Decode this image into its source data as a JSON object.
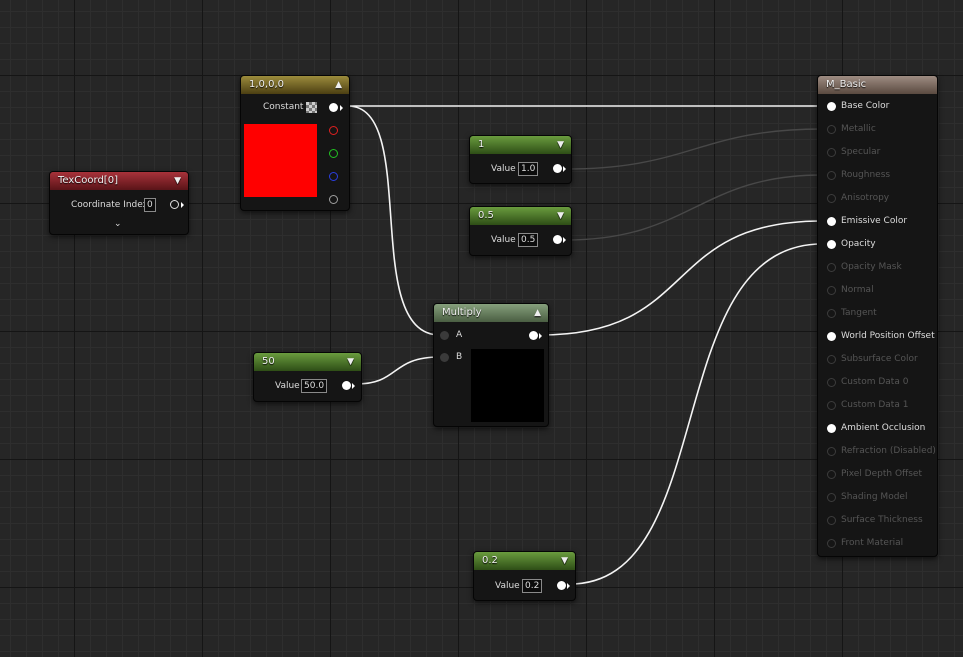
{
  "nodes": {
    "texcoord": {
      "title": "TexCoord[0]",
      "pin_label": "Coordinate Index",
      "value": "0"
    },
    "constant": {
      "title": "1,0,0,0",
      "pin_label": "Constant"
    },
    "const1": {
      "title": "1",
      "pin_label": "Value",
      "value": "1.0"
    },
    "const05": {
      "title": "0.5",
      "pin_label": "Value",
      "value": "0.5"
    },
    "const50": {
      "title": "50",
      "pin_label": "Value",
      "value": "50.0"
    },
    "multiply": {
      "title": "Multiply",
      "input_a": "A",
      "input_b": "B"
    },
    "const02": {
      "title": "0.2",
      "pin_label": "Value",
      "value": "0.2"
    },
    "material": {
      "title": "M_Basic",
      "pins": [
        {
          "label": "Base Color",
          "active": true
        },
        {
          "label": "Metallic",
          "active": false
        },
        {
          "label": "Specular",
          "active": false
        },
        {
          "label": "Roughness",
          "active": false
        },
        {
          "label": "Anisotropy",
          "active": false
        },
        {
          "label": "Emissive Color",
          "active": true
        },
        {
          "label": "Opacity",
          "active": true
        },
        {
          "label": "Opacity Mask",
          "active": false
        },
        {
          "label": "Normal",
          "active": false
        },
        {
          "label": "Tangent",
          "active": false
        },
        {
          "label": "World Position Offset",
          "active": true
        },
        {
          "label": "Subsurface Color",
          "active": false
        },
        {
          "label": "Custom Data 0",
          "active": false
        },
        {
          "label": "Custom Data 1",
          "active": false
        },
        {
          "label": "Ambient Occlusion",
          "active": true
        },
        {
          "label": "Refraction (Disabled)",
          "active": false
        },
        {
          "label": "Pixel Depth Offset",
          "active": false
        },
        {
          "label": "Shading Model",
          "active": false
        },
        {
          "label": "Surface Thickness",
          "active": false
        },
        {
          "label": "Front Material",
          "active": false
        }
      ]
    }
  },
  "colors": {
    "constant_preview": "#ff0000",
    "multiply_preview": "#000000",
    "wire_active": "#ffffff",
    "wire_inactive": "#4a4a4a"
  },
  "icons": {
    "collapse": "chevron-up-icon",
    "expand": "chevron-down-icon",
    "alpha": "checkerboard-icon"
  }
}
